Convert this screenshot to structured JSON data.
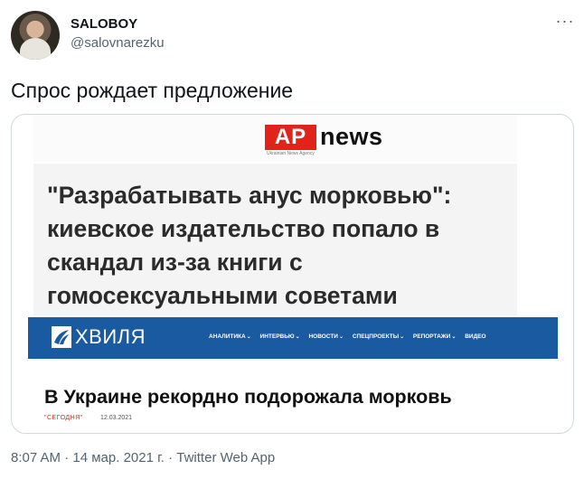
{
  "author": {
    "display_name": "SALOBOY",
    "handle": "@salovnarezku"
  },
  "more_glyph": "···",
  "tweet": {
    "text": "Спрос рождает предложение"
  },
  "media": {
    "apnews": {
      "logo_box": "AP",
      "logo_word": "news",
      "logo_sub": "Ukrainian News Agency",
      "headline": "\"Разрабатывать анус морковью\": киевское издательство попало в скандал из-за книги с гомосексуальными советами",
      "brand_color": "#e2231a"
    },
    "khvylia": {
      "logo": "ХВИЛЯ",
      "bar_color": "#1a5aa0",
      "nav": [
        {
          "label": "АНАЛИТИКА"
        },
        {
          "label": "ИНТЕРВЬЮ"
        },
        {
          "label": "НОВОСТИ"
        },
        {
          "label": "СПЕЦПРОЕКТЫ"
        },
        {
          "label": "РЕПОРТАЖИ"
        },
        {
          "label": "ВИДЕО"
        }
      ],
      "nav_chevron": "⌄",
      "headline": "В Украине рекордно подорожала морковь",
      "today_label": "\"СЕГОДНЯ\"",
      "date": "12.03.2021"
    }
  },
  "meta": {
    "time": "8:07 AM",
    "date": "14 мар. 2021 г.",
    "separator": "·",
    "source": "Twitter Web App"
  }
}
